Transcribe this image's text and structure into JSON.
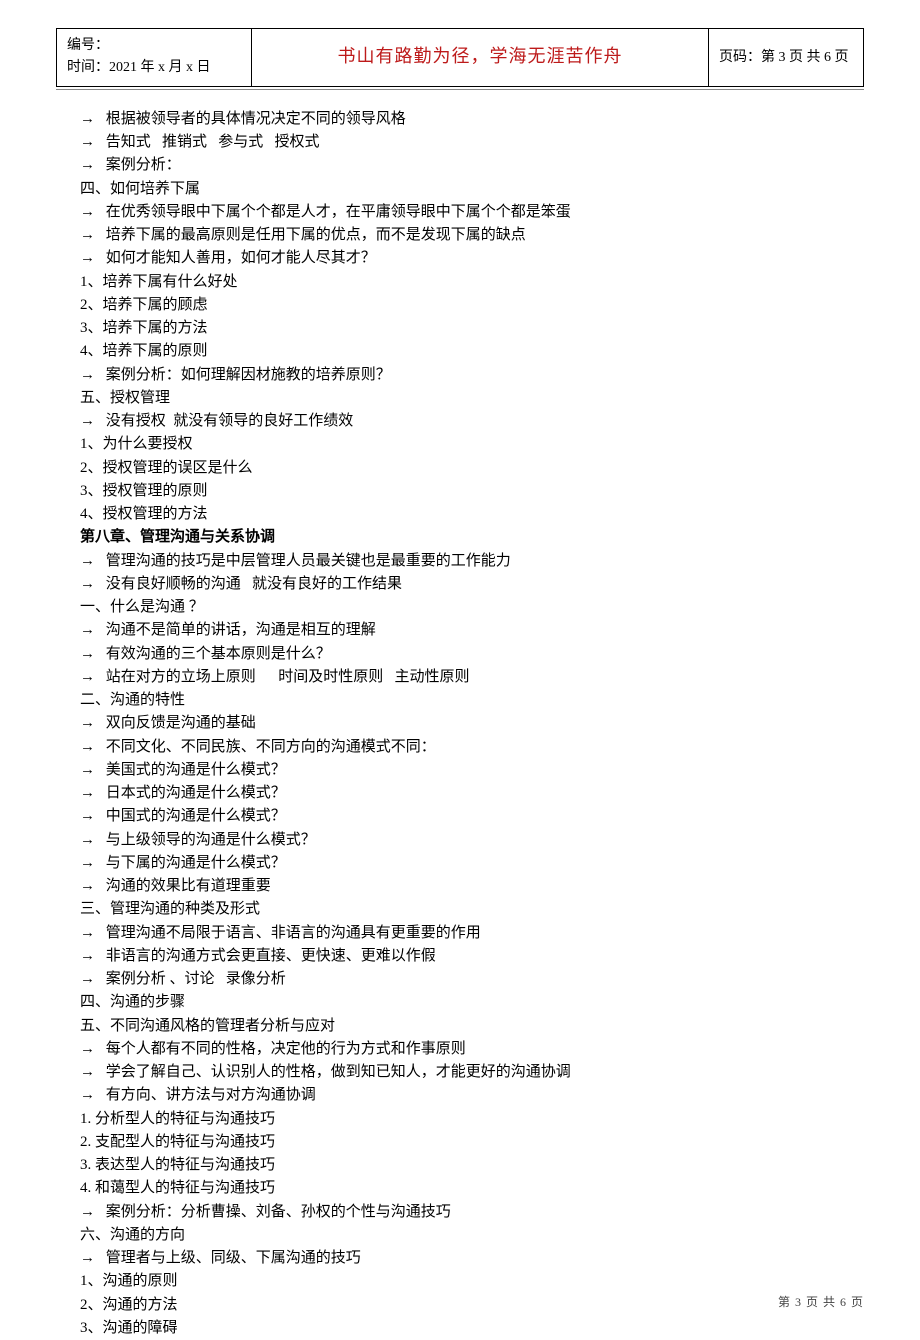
{
  "header": {
    "left_line1": "编号：",
    "left_line2": "时间：2021 年 x 月 x 日",
    "mid": "书山有路勤为径，学海无涯苦作舟",
    "right": "页码：第 3 页  共 6 页"
  },
  "lines": [
    {
      "t": "a",
      "v": "根据被领导者的具体情况决定不同的领导风格"
    },
    {
      "t": "a",
      "v": "告知式   推销式   参与式   授权式"
    },
    {
      "t": "a",
      "v": "案例分析："
    },
    {
      "t": "p",
      "v": "四、如何培养下属"
    },
    {
      "t": "a",
      "v": "在优秀领导眼中下属个个都是人才，在平庸领导眼中下属个个都是笨蛋"
    },
    {
      "t": "a",
      "v": "培养下属的最高原则是任用下属的优点，而不是发现下属的缺点"
    },
    {
      "t": "a",
      "v": "如何才能知人善用，如何才能人尽其才？"
    },
    {
      "t": "p",
      "v": "1、培养下属有什么好处"
    },
    {
      "t": "p",
      "v": "2、培养下属的顾虑"
    },
    {
      "t": "p",
      "v": "3、培养下属的方法"
    },
    {
      "t": "p",
      "v": "4、培养下属的原则"
    },
    {
      "t": "a",
      "v": "案例分析：如何理解因材施教的培养原则？"
    },
    {
      "t": "p",
      "v": "五、授权管理"
    },
    {
      "t": "a",
      "v": "没有授权  就没有领导的良好工作绩效"
    },
    {
      "t": "p",
      "v": "1、为什么要授权"
    },
    {
      "t": "p",
      "v": "2、授权管理的误区是什么"
    },
    {
      "t": "p",
      "v": "3、授权管理的原则"
    },
    {
      "t": "p",
      "v": "4、授权管理的方法"
    },
    {
      "t": "b",
      "v": "第八章、管理沟通与关系协调"
    },
    {
      "t": "a",
      "v": "管理沟通的技巧是中层管理人员最关键也是最重要的工作能力"
    },
    {
      "t": "a",
      "v": "没有良好顺畅的沟通   就没有良好的工作结果"
    },
    {
      "t": "p",
      "v": "一、什么是沟通 ？"
    },
    {
      "t": "a",
      "v": "沟通不是简单的讲话，沟通是相互的理解"
    },
    {
      "t": "a",
      "v": "有效沟通的三个基本原则是什么？"
    },
    {
      "t": "a",
      "v": "站在对方的立场上原则      时间及时性原则   主动性原则"
    },
    {
      "t": "p",
      "v": "二、沟通的特性"
    },
    {
      "t": "a",
      "v": "双向反馈是沟通的基础"
    },
    {
      "t": "a",
      "v": "不同文化、不同民族、不同方向的沟通模式不同："
    },
    {
      "t": "a",
      "v": "美国式的沟通是什么模式？"
    },
    {
      "t": "a",
      "v": "日本式的沟通是什么模式？"
    },
    {
      "t": "a",
      "v": "中国式的沟通是什么模式？"
    },
    {
      "t": "a",
      "v": "与上级领导的沟通是什么模式？"
    },
    {
      "t": "a",
      "v": "与下属的沟通是什么模式？"
    },
    {
      "t": "a",
      "v": "沟通的效果比有道理重要"
    },
    {
      "t": "p",
      "v": "三、管理沟通的种类及形式"
    },
    {
      "t": "a",
      "v": "管理沟通不局限于语言、非语言的沟通具有更重要的作用"
    },
    {
      "t": "a",
      "v": "非语言的沟通方式会更直接、更快速、更难以作假"
    },
    {
      "t": "a",
      "v": "案例分析 、讨论   录像分析"
    },
    {
      "t": "p",
      "v": "四、沟通的步骤"
    },
    {
      "t": "p",
      "v": "五、不同沟通风格的管理者分析与应对"
    },
    {
      "t": "a",
      "v": "每个人都有不同的性格，决定他的行为方式和作事原则"
    },
    {
      "t": "a",
      "v": "学会了解自己、认识别人的性格，做到知已知人，才能更好的沟通协调"
    },
    {
      "t": "a",
      "v": "有方向、讲方法与对方沟通协调"
    },
    {
      "t": "p",
      "v": "1. 分析型人的特征与沟通技巧"
    },
    {
      "t": "p",
      "v": "2. 支配型人的特征与沟通技巧"
    },
    {
      "t": "p",
      "v": "3. 表达型人的特征与沟通技巧"
    },
    {
      "t": "p",
      "v": "4. 和蔼型人的特征与沟通技巧"
    },
    {
      "t": "a",
      "v": "案例分析：分析曹操、刘备、孙权的个性与沟通技巧"
    },
    {
      "t": "p",
      "v": "六、沟通的方向"
    },
    {
      "t": "a",
      "v": "管理者与上级、同级、下属沟通的技巧"
    },
    {
      "t": "p",
      "v": "1、沟通的原则"
    },
    {
      "t": "p",
      "v": "2、沟通的方法"
    },
    {
      "t": "p",
      "v": "3、沟通的障碍"
    }
  ],
  "footer": "第 3 页 共 6 页"
}
